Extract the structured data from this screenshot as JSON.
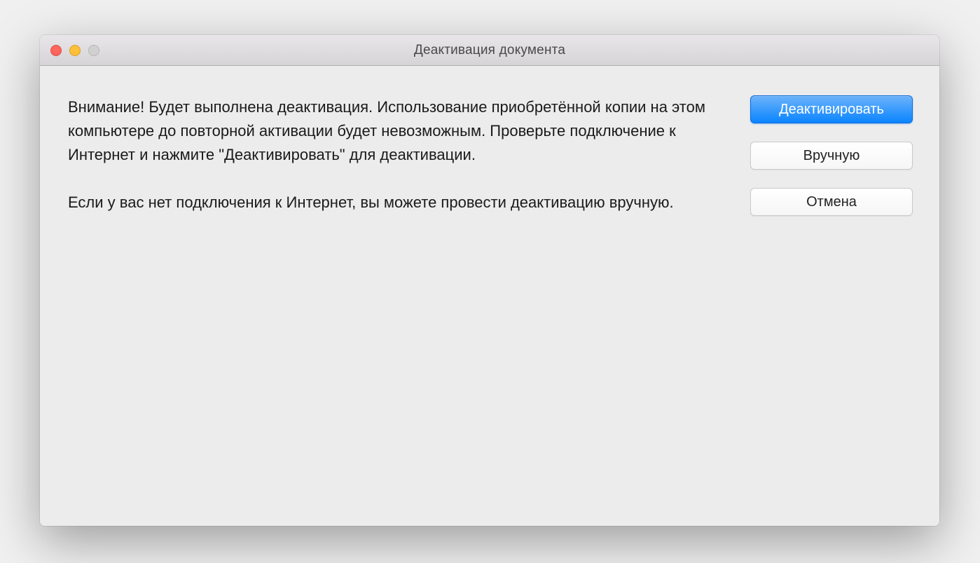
{
  "window": {
    "title": "Деактивация документа"
  },
  "message": {
    "paragraph1": "Внимание! Будет выполнена деактивация. Использование приобретённой копии на этом компьютере до повторной активации будет невозможным. Проверьте подключение к Интернет и нажмите \"Деактивировать\" для деактивации.",
    "paragraph2": "Если у вас нет подключения к Интернет, вы можете провести деактивацию вручную."
  },
  "buttons": {
    "deactivate": "Деактивировать",
    "manual": "Вручную",
    "cancel": "Отмена"
  }
}
